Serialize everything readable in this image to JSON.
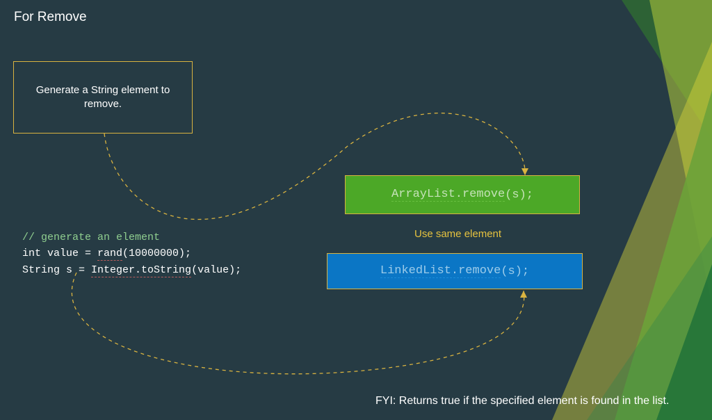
{
  "title": "For Remove",
  "generate_box": "Generate a String element to remove.",
  "code": {
    "line1_comment": "// generate an element",
    "line2_pre": "int value = ",
    "line2_fn": "rand",
    "line2_post": "(10000000);",
    "line3_pre": "String s = ",
    "line3_fn": "Integer.toString",
    "line3_post": "(value);"
  },
  "arraylist": {
    "name": "ArrayList.remove",
    "rest": "(s);"
  },
  "use_same": "Use same element",
  "linkedlist": {
    "name": "LinkedList.remove",
    "rest": "(s);"
  },
  "fyi": "FYI: Returns true if the specified element is found in the list.",
  "colors": {
    "bg": "#263b44",
    "accent": "#d9b340",
    "green_box": "#4ca827",
    "blue_box": "#0b76c5"
  }
}
